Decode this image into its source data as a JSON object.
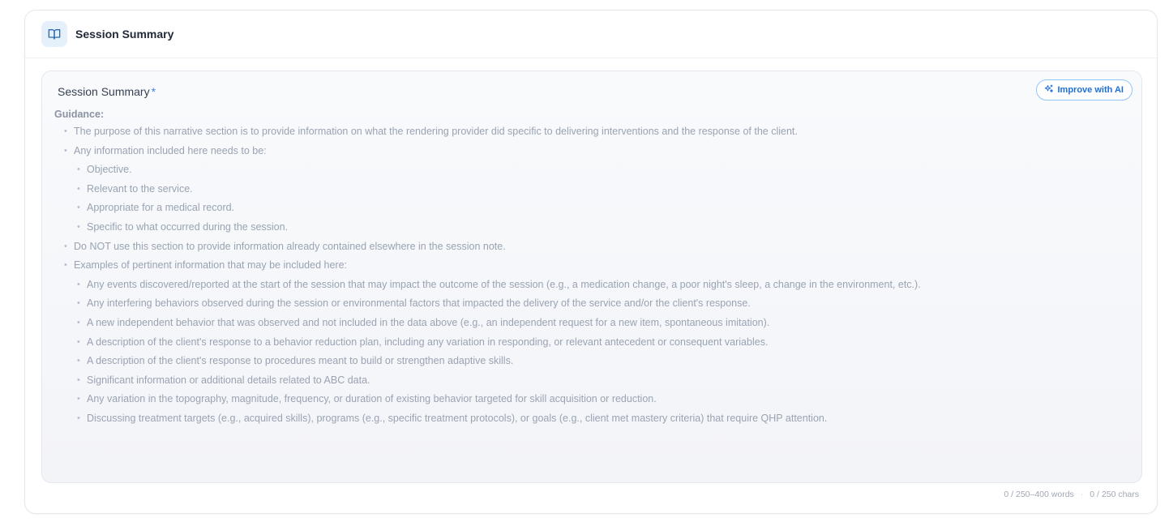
{
  "card": {
    "title": "Session Summary",
    "icon": "book-open-icon"
  },
  "field": {
    "label": "Session Summary",
    "required_mark": "*",
    "ai_button_label": "Improve with AI",
    "ai_icon": "sparkles-icon"
  },
  "guidance": {
    "title": "Guidance:",
    "items": [
      {
        "level": 1,
        "text": "The purpose of this narrative section is to provide information on what the rendering provider did specific to delivering interventions and the response of the client."
      },
      {
        "level": 1,
        "text": "Any information included here needs to be:"
      },
      {
        "level": 2,
        "text": "Objective."
      },
      {
        "level": 2,
        "text": "Relevant to the service."
      },
      {
        "level": 2,
        "text": "Appropriate for a medical record."
      },
      {
        "level": 2,
        "text": "Specific to what occurred during the session."
      },
      {
        "level": 1,
        "text": "Do NOT use this section to provide information already contained elsewhere in the session note."
      },
      {
        "level": 1,
        "text": "Examples of pertinent information that may be included here:"
      },
      {
        "level": 2,
        "text": "Any events discovered/reported at the start of the session that may impact the outcome of the session (e.g., a medication change, a poor night's sleep, a change in the environment, etc.)."
      },
      {
        "level": 2,
        "text": "Any interfering behaviors observed during the session or environmental factors that impacted the delivery of the service and/or the client's response."
      },
      {
        "level": 2,
        "text": "A new independent behavior that was observed and not included in the data above (e.g., an independent request for a new item, spontaneous imitation)."
      },
      {
        "level": 2,
        "text": "A description of the client's response to a behavior reduction plan, including any variation in responding, or relevant antecedent or consequent variables."
      },
      {
        "level": 2,
        "text": "A description of the client's response to procedures meant to build or strengthen adaptive skills."
      },
      {
        "level": 2,
        "text": "Significant information or additional details related to ABC data."
      },
      {
        "level": 2,
        "text": "Any variation in the topography, magnitude, frequency, or duration of existing behavior targeted for skill acquisition or reduction."
      },
      {
        "level": 2,
        "text": "Discussing treatment targets (e.g., acquired skills), programs (e.g., specific treatment protocols), or goals (e.g., client met mastery criteria) that require QHP attention."
      }
    ]
  },
  "counts": {
    "words": "0 / 250–400 words",
    "separator": "·",
    "chars": "0 / 250 chars"
  },
  "colors": {
    "accent": "#1d6fd6",
    "required": "#3b82f6",
    "icon_bg": "#e6f0fa"
  }
}
